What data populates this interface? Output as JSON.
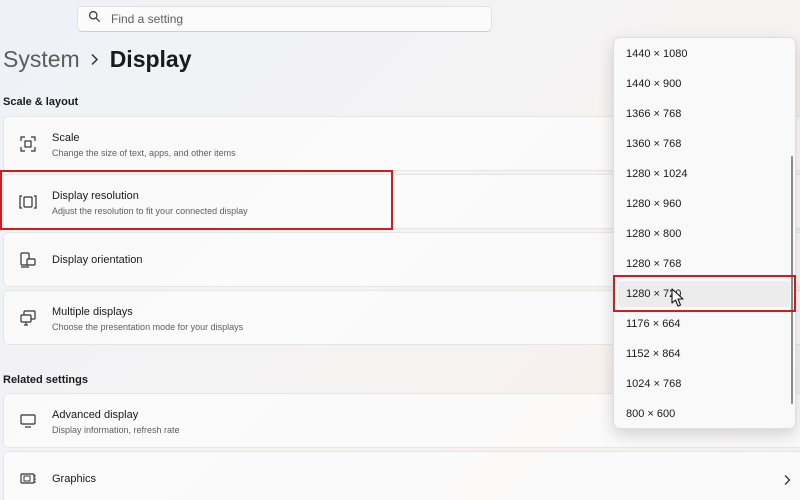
{
  "search": {
    "placeholder": "Find a setting"
  },
  "breadcrumb": {
    "parent": "System",
    "current": "Display"
  },
  "sections": {
    "scale_layout": "Scale & layout",
    "related": "Related settings"
  },
  "cards": {
    "scale": {
      "title": "Scale",
      "desc": "Change the size of text, apps, and other items"
    },
    "resolution": {
      "title": "Display resolution",
      "desc": "Adjust the resolution to fit your connected display"
    },
    "orientation": {
      "title": "Display orientation"
    },
    "multiple": {
      "title": "Multiple displays",
      "desc": "Choose the presentation mode for your displays"
    },
    "advanced": {
      "title": "Advanced display",
      "desc": "Display information, refresh rate"
    },
    "graphics": {
      "title": "Graphics"
    }
  },
  "resolution_options": [
    "1440 × 1080",
    "1440 × 900",
    "1366 × 768",
    "1360 × 768",
    "1280 × 1024",
    "1280 × 960",
    "1280 × 800",
    "1280 × 768",
    "1280 × 720",
    "1176 × 664",
    "1152 × 864",
    "1024 × 768",
    "800 × 600"
  ],
  "hovered_option": "1280 × 720",
  "colors": {
    "highlight": "#c8201e",
    "background": "#f3f3f3"
  },
  "icons": [
    "search-icon",
    "chevron-right-icon",
    "scale-icon",
    "resolution-icon",
    "orientation-icon",
    "multiple-displays-icon",
    "monitor-icon",
    "graphics-icon",
    "mouse-cursor-icon"
  ]
}
